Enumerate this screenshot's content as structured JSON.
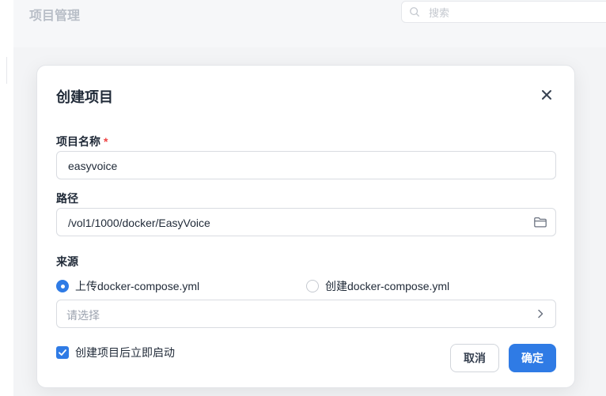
{
  "page": {
    "title": "项目管理",
    "search_placeholder": "搜索"
  },
  "modal": {
    "title": "创建项目",
    "close_icon": "close-icon",
    "name_field": {
      "label": "项目名称",
      "required_mark": "*",
      "value": "easyvoice"
    },
    "path_field": {
      "label": "路径",
      "value": "/vol1/1000/docker/EasyVoice",
      "icon": "folder-icon"
    },
    "source": {
      "label": "来源",
      "options": [
        {
          "label": "上传docker-compose.yml",
          "selected": true
        },
        {
          "label": "创建docker-compose.yml",
          "selected": false
        }
      ],
      "select_placeholder": "请选择"
    },
    "auto_start": {
      "label": "创建项目后立即启动",
      "checked": true
    },
    "buttons": {
      "cancel": "取消",
      "confirm": "确定"
    }
  },
  "colors": {
    "primary": "#2f7be5",
    "required": "#ef4444"
  }
}
